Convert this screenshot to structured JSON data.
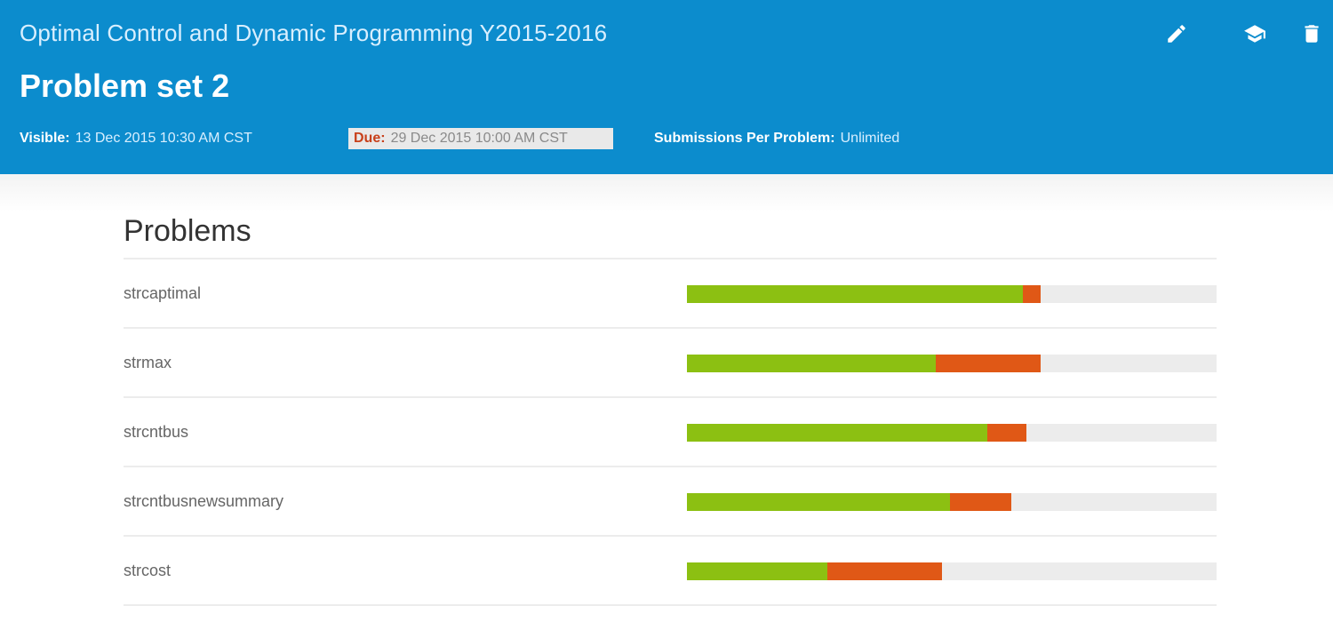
{
  "header": {
    "course_title": "Optimal Control and Dynamic Programming Y2015-2016",
    "problem_set_title": "Problem set 2",
    "visible_label": "Visible:",
    "visible_value": "13 Dec 2015 10:30 AM CST",
    "due_label": "Due:",
    "due_value": "29 Dec 2015 10:00 AM CST",
    "submissions_label": "Submissions Per Problem:",
    "submissions_value": "Unlimited",
    "icons": [
      "edit-icon",
      "grade-icon",
      "delete-icon"
    ],
    "background_color": "#0c8ccd"
  },
  "problems_section": {
    "heading": "Problems",
    "colors": {
      "correct": "#8cc012",
      "incorrect": "#e05816",
      "empty": "#ececec"
    },
    "items": [
      {
        "name": "strcaptimal",
        "correct_fraction": 0.635,
        "incorrect_fraction": 0.033
      },
      {
        "name": "strmax",
        "correct_fraction": 0.469,
        "incorrect_fraction": 0.199
      },
      {
        "name": "strcntbus",
        "correct_fraction": 0.567,
        "incorrect_fraction": 0.074
      },
      {
        "name": "strcntbusnewsummary",
        "correct_fraction": 0.496,
        "incorrect_fraction": 0.116
      },
      {
        "name": "strcost",
        "correct_fraction": 0.265,
        "incorrect_fraction": 0.217
      }
    ]
  }
}
